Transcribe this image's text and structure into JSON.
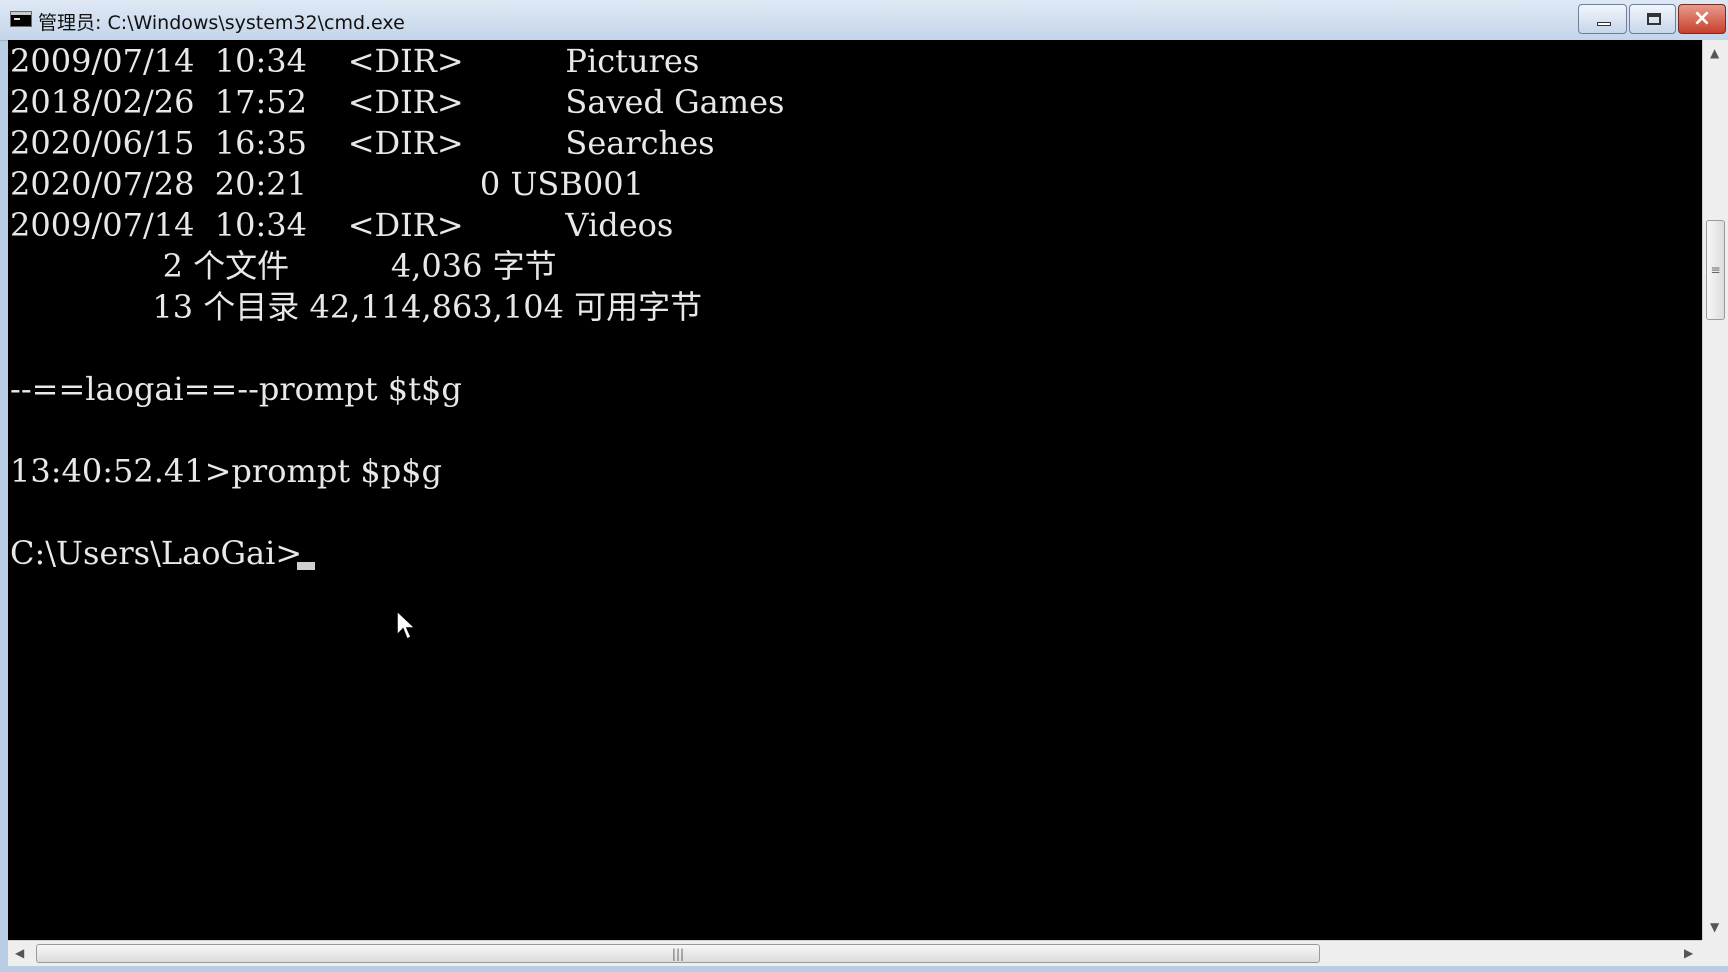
{
  "window": {
    "title": "管理员: C:\\Windows\\system32\\cmd.exe",
    "icon": "cmd-icon",
    "buttons": {
      "minimize": "minimize-icon",
      "maximize": "maximize-icon",
      "close": "×"
    }
  },
  "console": {
    "lines": [
      "2009/07/14  10:34    <DIR>          Pictures",
      "2018/02/26  17:52    <DIR>          Saved Games",
      "2020/06/15  16:35    <DIR>          Searches",
      "2020/07/28  20:21                 0 USB001",
      "2009/07/14  10:34    <DIR>          Videos",
      "               2 个文件          4,036 字节",
      "              13 个目录 42,114,863,104 可用字节",
      "",
      "--==laogai==--prompt $t$g",
      "",
      "13:40:52.41>prompt $p$g",
      "",
      "C:\\Users\\LaoGai>"
    ]
  },
  "scrollbars": {
    "vertical_grip": "≡",
    "horizontal_grip": "|||",
    "up_arrow": "▲",
    "down_arrow": "▼",
    "left_arrow": "◀",
    "right_arrow": "▶"
  }
}
